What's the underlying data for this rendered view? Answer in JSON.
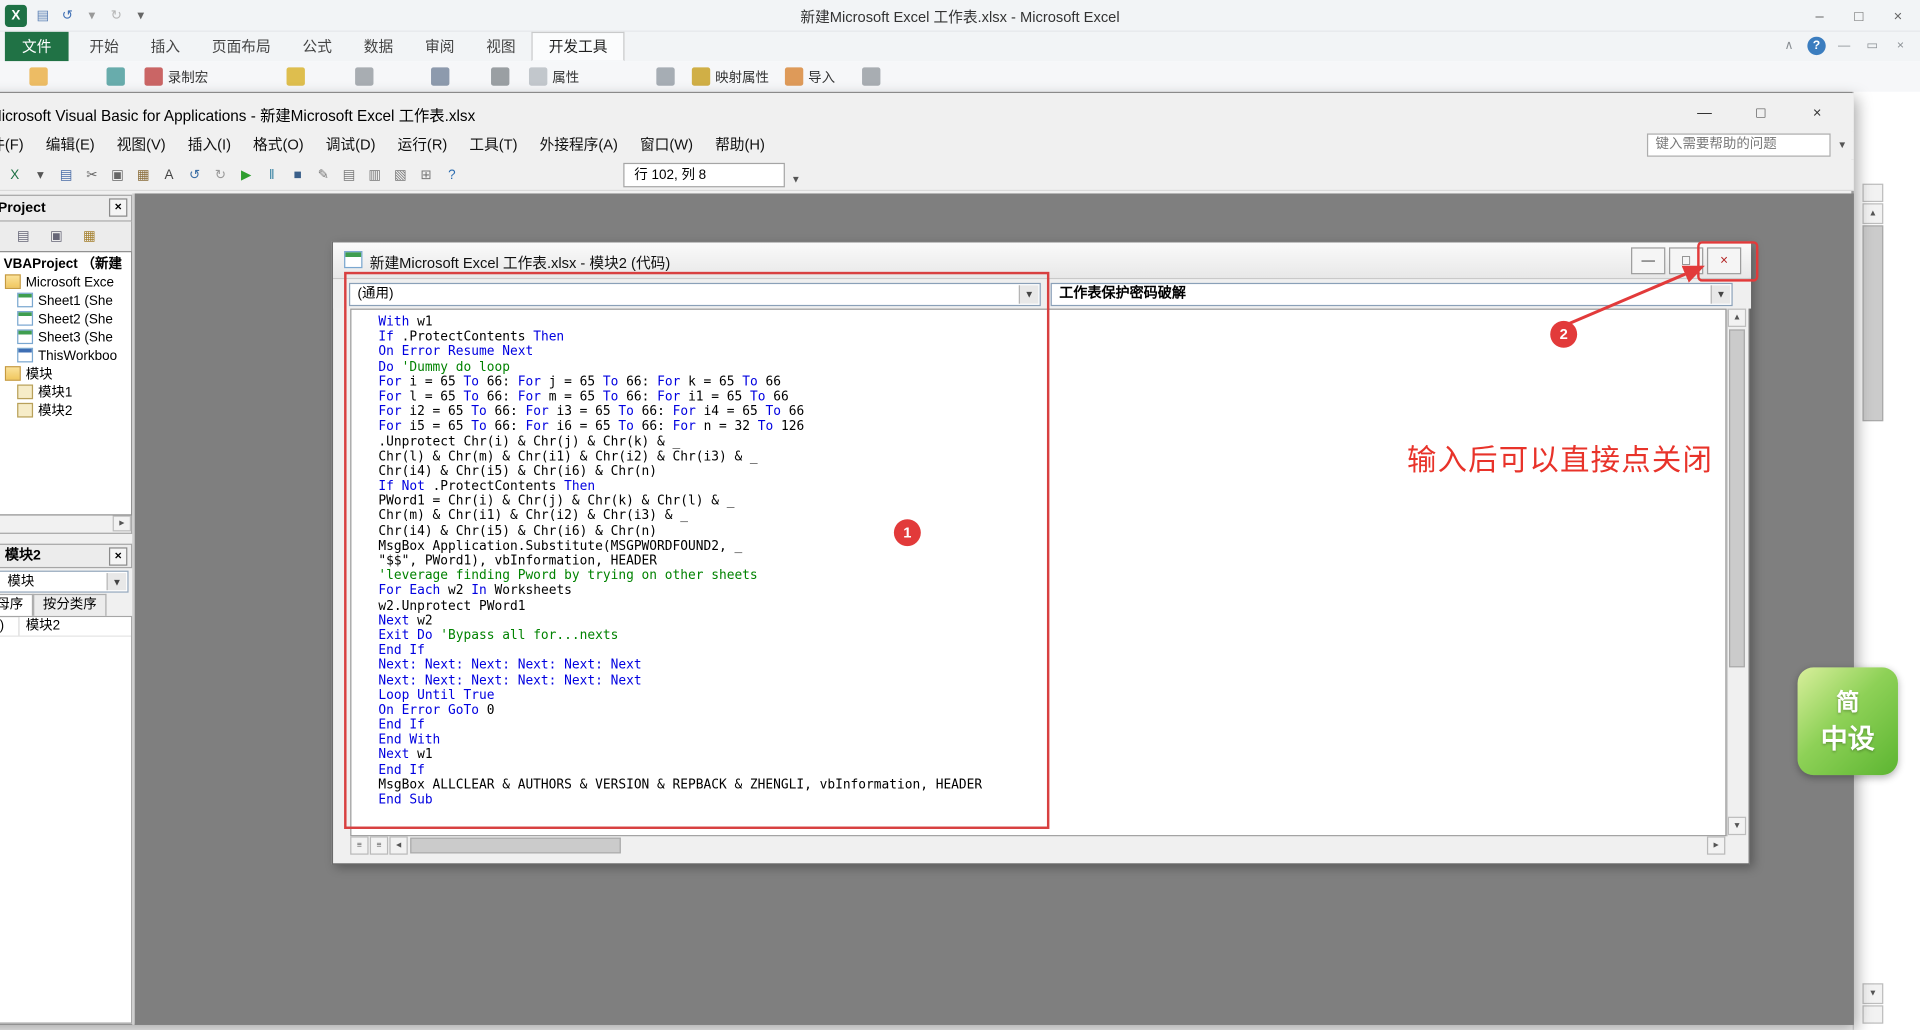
{
  "colors": {
    "annotation_red": "#e23a3a",
    "excel_green": "#207245",
    "mdi_gray": "#7f7f7f",
    "keyword_blue": "#0000e0",
    "comment_green": "#008200"
  },
  "excel": {
    "window_title": "新建Microsoft Excel 工作表.xlsx - Microsoft Excel",
    "file_tab": "文件",
    "tabs": [
      "开始",
      "插入",
      "页面布局",
      "公式",
      "数据",
      "审阅",
      "视图",
      "开发工具"
    ],
    "active_tab": "开发工具",
    "quick_access": [
      {
        "name": "excel-logo-icon",
        "glyph": "X",
        "color": "#fff",
        "bg": "#1e7145"
      },
      {
        "name": "save-icon",
        "glyph": "▤",
        "color": "#5b7fb4"
      },
      {
        "name": "undo-icon",
        "glyph": "↺",
        "color": "#3f6fb4"
      },
      {
        "name": "undo-dropdown-icon",
        "glyph": "▾",
        "color": "#999"
      },
      {
        "name": "redo-icon",
        "glyph": "↻",
        "color": "#b5b5b5"
      },
      {
        "name": "qat-dropdown-icon",
        "glyph": "▾",
        "color": "#666"
      }
    ],
    "window_buttons": [
      {
        "name": "app-minimize-button",
        "glyph": "–",
        "color": "#666"
      },
      {
        "name": "app-maximize-button",
        "glyph": "□",
        "color": "#666"
      },
      {
        "name": "app-close-button",
        "glyph": "×",
        "color": "#666"
      }
    ],
    "ribbon_right": [
      {
        "name": "collapse-ribbon-icon",
        "glyph": "∧"
      },
      {
        "name": "help-icon",
        "glyph": "?",
        "circle": true
      },
      {
        "name": "book-minimize-icon",
        "glyph": "—"
      },
      {
        "name": "book-restore-icon",
        "glyph": "▭"
      },
      {
        "name": "book-close-icon",
        "glyph": "×"
      }
    ],
    "ribbon_items": [
      {
        "name": "visual-basic-icon",
        "label": "",
        "color": "#ebb24a"
      },
      {
        "name": "macros-icon",
        "label": "",
        "color": "#4f9f9f"
      },
      {
        "name": "record-macro-icon",
        "label": "录制宏",
        "color": "#c24b4b"
      },
      {
        "name": "macro-security-icon",
        "label": "",
        "color": "#d9b430"
      },
      {
        "name": "add-ins-icon",
        "label": "",
        "color": "#9aa0a6"
      },
      {
        "name": "com-add-ins-icon",
        "label": "",
        "color": "#7a8aa0"
      },
      {
        "name": "insert-control-icon",
        "label": "",
        "color": "#8a8f94"
      },
      {
        "name": "properties-icon",
        "label": "属性",
        "color": "#b9bec4"
      },
      {
        "name": "view-code-icon",
        "label": "",
        "color": "#98a0a8"
      },
      {
        "name": "map-properties-icon",
        "label": "映射属性",
        "color": "#c9a227"
      },
      {
        "name": "import-icon",
        "label": "导入",
        "color": "#d98a3d"
      },
      {
        "name": "export-icon",
        "label": "",
        "color": "#9aa0a6"
      }
    ]
  },
  "vba": {
    "window_title": "Microsoft Visual Basic for Applications - 新建Microsoft Excel 工作表.xlsx",
    "menu_items": [
      "文件(F)",
      "编辑(E)",
      "视图(V)",
      "插入(I)",
      "格式(O)",
      "调试(D)",
      "运行(R)",
      "工具(T)",
      "外接程序(A)",
      "窗口(W)",
      "帮助(H)"
    ],
    "help_box_placeholder": "键入需要帮助的问题",
    "position_indicator": "行 102, 列 8",
    "window_buttons": [
      {
        "name": "vba-minimize-button",
        "glyph": "—",
        "color": "#333"
      },
      {
        "name": "vba-maximize-button",
        "glyph": "□",
        "color": "#333"
      },
      {
        "name": "vba-close-button",
        "glyph": "×",
        "color": "#333"
      }
    ],
    "toolbar_icons": [
      {
        "name": "view-excel-icon",
        "glyph": "X",
        "color": "#1e7145"
      },
      {
        "name": "view-dropdown-icon",
        "glyph": "▾",
        "color": "#555"
      },
      {
        "name": "save-icon",
        "glyph": "▤",
        "color": "#4a6da7"
      },
      {
        "name": "cut-icon",
        "glyph": "✂",
        "color": "#666"
      },
      {
        "name": "copy-icon",
        "glyph": "▣",
        "color": "#666"
      },
      {
        "name": "paste-icon",
        "glyph": "▦",
        "color": "#8a6d3b"
      },
      {
        "name": "find-icon",
        "glyph": "A",
        "color": "#444"
      },
      {
        "name": "undo-icon",
        "glyph": "↺",
        "color": "#3a6ea5"
      },
      {
        "name": "redo-icon",
        "glyph": "↻",
        "color": "#9a9a9a"
      },
      {
        "name": "run-icon",
        "glyph": "▶",
        "color": "#2e9e2e"
      },
      {
        "name": "break-icon",
        "glyph": "‖",
        "color": "#2e7d9e"
      },
      {
        "name": "reset-icon",
        "glyph": "■",
        "color": "#3a5f8a"
      },
      {
        "name": "design-mode-icon",
        "glyph": "✎",
        "color": "#777"
      },
      {
        "name": "project-explorer-icon",
        "glyph": "▤",
        "color": "#777"
      },
      {
        "name": "properties-window-icon",
        "glyph": "▥",
        "color": "#777"
      },
      {
        "name": "object-browser-icon",
        "glyph": "▧",
        "color": "#777"
      },
      {
        "name": "toolbox-icon",
        "glyph": "⊞",
        "color": "#777"
      },
      {
        "name": "help-icon",
        "glyph": "?",
        "color": "#2b6cb0"
      }
    ],
    "project_panel": {
      "title": "VBAProject",
      "toolbar_icons": [
        {
          "name": "view-code-icon",
          "glyph": "▤",
          "color": "#667"
        },
        {
          "name": "view-object-icon",
          "glyph": "▣",
          "color": "#667"
        },
        {
          "name": "toggle-folders-icon",
          "glyph": "▦",
          "color": "#a5812f"
        }
      ],
      "tree": [
        {
          "label": "VBAProject （新建",
          "bold": true,
          "icon": "project",
          "indent": 0
        },
        {
          "label": "Microsoft Exce",
          "icon": "folder",
          "indent": 1
        },
        {
          "label": "Sheet1 (She",
          "icon": "worksheet",
          "indent": 2
        },
        {
          "label": "Sheet2 (She",
          "icon": "worksheet",
          "indent": 2
        },
        {
          "label": "Sheet3 (She",
          "icon": "worksheet",
          "indent": 2
        },
        {
          "label": "ThisWorkboo",
          "icon": "workbook",
          "indent": 2
        },
        {
          "label": "模块",
          "icon": "folder",
          "indent": 1
        },
        {
          "label": "模块1",
          "icon": "module",
          "indent": 2
        },
        {
          "label": "模块2",
          "icon": "module",
          "indent": 2
        }
      ]
    },
    "properties_panel": {
      "title": "模块2",
      "object_dropdown": "模块",
      "tabs": [
        "按字母序",
        "按分类序"
      ],
      "rows": [
        {
          "name": "(名称)",
          "value": "模块2"
        }
      ]
    },
    "code_window": {
      "title": "新建Microsoft Excel 工作表.xlsx - 模块2 (代码)",
      "left_dropdown": "(通用)",
      "right_dropdown": "工作表保护密码破解",
      "window_buttons": [
        {
          "name": "code-minimize-button",
          "glyph": "—",
          "color": "#333"
        },
        {
          "name": "code-restore-button",
          "glyph": "□",
          "color": "#333"
        },
        {
          "name": "code-close-button",
          "glyph": "×",
          "color": "#b22222"
        }
      ],
      "code_lines": [
        [
          {
            "t": "With",
            "c": "k"
          },
          {
            "t": " w1",
            "c": "n"
          }
        ],
        [
          {
            "t": "If",
            "c": "k"
          },
          {
            "t": " .ProtectContents ",
            "c": "n"
          },
          {
            "t": "Then",
            "c": "k"
          }
        ],
        [
          {
            "t": "On Error Resume Next",
            "c": "k"
          }
        ],
        [
          {
            "t": "Do ",
            "c": "k"
          },
          {
            "t": "'Dummy do loop",
            "c": "c"
          }
        ],
        [
          {
            "t": "For",
            "c": "k"
          },
          {
            "t": " i = 65 ",
            "c": "n"
          },
          {
            "t": "To",
            "c": "k"
          },
          {
            "t": " 66: ",
            "c": "n"
          },
          {
            "t": "For",
            "c": "k"
          },
          {
            "t": " j = 65 ",
            "c": "n"
          },
          {
            "t": "To",
            "c": "k"
          },
          {
            "t": " 66: ",
            "c": "n"
          },
          {
            "t": "For",
            "c": "k"
          },
          {
            "t": " k = 65 ",
            "c": "n"
          },
          {
            "t": "To",
            "c": "k"
          },
          {
            "t": " 66",
            "c": "n"
          }
        ],
        [
          {
            "t": "For",
            "c": "k"
          },
          {
            "t": " l = 65 ",
            "c": "n"
          },
          {
            "t": "To",
            "c": "k"
          },
          {
            "t": " 66: ",
            "c": "n"
          },
          {
            "t": "For",
            "c": "k"
          },
          {
            "t": " m = 65 ",
            "c": "n"
          },
          {
            "t": "To",
            "c": "k"
          },
          {
            "t": " 66: ",
            "c": "n"
          },
          {
            "t": "For",
            "c": "k"
          },
          {
            "t": " i1 = 65 ",
            "c": "n"
          },
          {
            "t": "To",
            "c": "k"
          },
          {
            "t": " 66",
            "c": "n"
          }
        ],
        [
          {
            "t": "For",
            "c": "k"
          },
          {
            "t": " i2 = 65 ",
            "c": "n"
          },
          {
            "t": "To",
            "c": "k"
          },
          {
            "t": " 66: ",
            "c": "n"
          },
          {
            "t": "For",
            "c": "k"
          },
          {
            "t": " i3 = 65 ",
            "c": "n"
          },
          {
            "t": "To",
            "c": "k"
          },
          {
            "t": " 66: ",
            "c": "n"
          },
          {
            "t": "For",
            "c": "k"
          },
          {
            "t": " i4 = 65 ",
            "c": "n"
          },
          {
            "t": "To",
            "c": "k"
          },
          {
            "t": " 66",
            "c": "n"
          }
        ],
        [
          {
            "t": "For",
            "c": "k"
          },
          {
            "t": " i5 = 65 ",
            "c": "n"
          },
          {
            "t": "To",
            "c": "k"
          },
          {
            "t": " 66: ",
            "c": "n"
          },
          {
            "t": "For",
            "c": "k"
          },
          {
            "t": " i6 = 65 ",
            "c": "n"
          },
          {
            "t": "To",
            "c": "k"
          },
          {
            "t": " 66: ",
            "c": "n"
          },
          {
            "t": "For",
            "c": "k"
          },
          {
            "t": " n = 32 ",
            "c": "n"
          },
          {
            "t": "To",
            "c": "k"
          },
          {
            "t": " 126",
            "c": "n"
          }
        ],
        [
          {
            "t": ".Unprotect Chr(i) & Chr(j) & Chr(k) & _",
            "c": "n"
          }
        ],
        [
          {
            "t": "Chr(l) & Chr(m) & Chr(i1) & Chr(i2) & Chr(i3) & _",
            "c": "n"
          }
        ],
        [
          {
            "t": "Chr(i4) & Chr(i5) & Chr(i6) & Chr(n)",
            "c": "n"
          }
        ],
        [
          {
            "t": "If Not",
            "c": "k"
          },
          {
            "t": " .ProtectContents ",
            "c": "n"
          },
          {
            "t": "Then",
            "c": "k"
          }
        ],
        [
          {
            "t": "PWord1 = Chr(i) & Chr(j) & Chr(k) & Chr(l) & _",
            "c": "n"
          }
        ],
        [
          {
            "t": "Chr(m) & Chr(i1) & Chr(i2) & Chr(i3) & _",
            "c": "n"
          }
        ],
        [
          {
            "t": "Chr(i4) & Chr(i5) & Chr(i6) & Chr(n)",
            "c": "n"
          }
        ],
        [
          {
            "t": "MsgBox Application.Substitute(MSGPWORDFOUND2, _",
            "c": "n"
          }
        ],
        [
          {
            "t": "\"$$\", PWord1), vbInformation, HEADER",
            "c": "n"
          }
        ],
        [
          {
            "t": "'leverage finding Pword by trying on other sheets",
            "c": "c"
          }
        ],
        [
          {
            "t": "For Each",
            "c": "k"
          },
          {
            "t": " w2 ",
            "c": "n"
          },
          {
            "t": "In",
            "c": "k"
          },
          {
            "t": " Worksheets",
            "c": "n"
          }
        ],
        [
          {
            "t": "w2.Unprotect PWord1",
            "c": "n"
          }
        ],
        [
          {
            "t": "Next",
            "c": "k"
          },
          {
            "t": " w2",
            "c": "n"
          }
        ],
        [
          {
            "t": "Exit Do ",
            "c": "k"
          },
          {
            "t": "'Bypass all for...nexts",
            "c": "c"
          }
        ],
        [
          {
            "t": "End If",
            "c": "k"
          }
        ],
        [
          {
            "t": "Next: Next: Next: Next: Next: Next",
            "c": "k"
          }
        ],
        [
          {
            "t": "Next: Next: Next: Next: Next: Next",
            "c": "k"
          }
        ],
        [
          {
            "t": "Loop Until True",
            "c": "k"
          }
        ],
        [
          {
            "t": "On Error GoTo",
            "c": "k"
          },
          {
            "t": " 0",
            "c": "n"
          }
        ],
        [
          {
            "t": "End If",
            "c": "k"
          }
        ],
        [
          {
            "t": "End With",
            "c": "k"
          }
        ],
        [
          {
            "t": "Next",
            "c": "k"
          },
          {
            "t": " w1",
            "c": "n"
          }
        ],
        [
          {
            "t": "End If",
            "c": "k"
          }
        ],
        [
          {
            "t": "MsgBox ALLCLEAR & AUTHORS & VERSION & REPBACK & ZHENGLI, vbInformation, HEADER",
            "c": "n"
          }
        ],
        [
          {
            "t": "End Sub",
            "c": "k"
          }
        ]
      ]
    }
  },
  "annotations": {
    "step1": "1",
    "step2": "2",
    "note": "输入后可以直接点关闭"
  },
  "logo": {
    "line1": "简",
    "line2": "中设"
  }
}
